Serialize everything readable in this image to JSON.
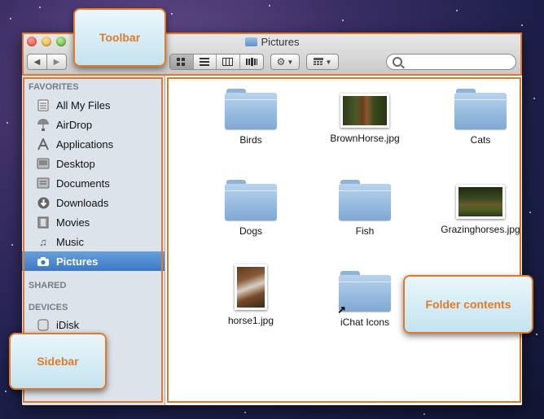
{
  "window": {
    "title": "Pictures"
  },
  "toolbar": {
    "back_icon": "chevron-left-icon",
    "forward_icon": "chevron-right-icon",
    "view_modes": [
      "icon-view",
      "list-view",
      "column-view",
      "coverflow-view"
    ],
    "active_view": "icon-view",
    "action_icon": "gear-icon",
    "arrange_icon": "arrange-grid-icon",
    "search_placeholder": ""
  },
  "sidebar": {
    "sections": [
      {
        "title": "FAVORITES",
        "items": [
          {
            "label": "All My Files",
            "icon": "all-files-icon"
          },
          {
            "label": "AirDrop",
            "icon": "airdrop-icon"
          },
          {
            "label": "Applications",
            "icon": "applications-icon"
          },
          {
            "label": "Desktop",
            "icon": "desktop-icon"
          },
          {
            "label": "Documents",
            "icon": "documents-icon"
          },
          {
            "label": "Downloads",
            "icon": "downloads-icon"
          },
          {
            "label": "Movies",
            "icon": "movies-icon"
          },
          {
            "label": "Music",
            "icon": "music-icon"
          },
          {
            "label": "Pictures",
            "icon": "camera-icon",
            "selected": true
          }
        ]
      },
      {
        "title": "SHARED",
        "items": []
      },
      {
        "title": "DEVICES",
        "items": [
          {
            "label": "iDisk",
            "icon": "idisk-icon"
          }
        ]
      }
    ]
  },
  "files": [
    {
      "name": "Birds",
      "kind": "folder"
    },
    {
      "name": "BrownHorse.jpg",
      "kind": "image"
    },
    {
      "name": "Cats",
      "kind": "folder"
    },
    {
      "name": "Dogs",
      "kind": "folder"
    },
    {
      "name": "Fish",
      "kind": "folder"
    },
    {
      "name": "Grazinghorses.jpg",
      "kind": "image"
    },
    {
      "name": "horse1.jpg",
      "kind": "image"
    },
    {
      "name": "iChat Icons",
      "kind": "alias-folder"
    }
  ],
  "callouts": {
    "toolbar": "Toolbar",
    "sidebar": "Sidebar",
    "folder_contents": "Folder contents"
  },
  "colors": {
    "callout_orange": "#e07a2a",
    "selection_blue": "#3c78c6",
    "sidebar_bg": "#dde3ea"
  }
}
